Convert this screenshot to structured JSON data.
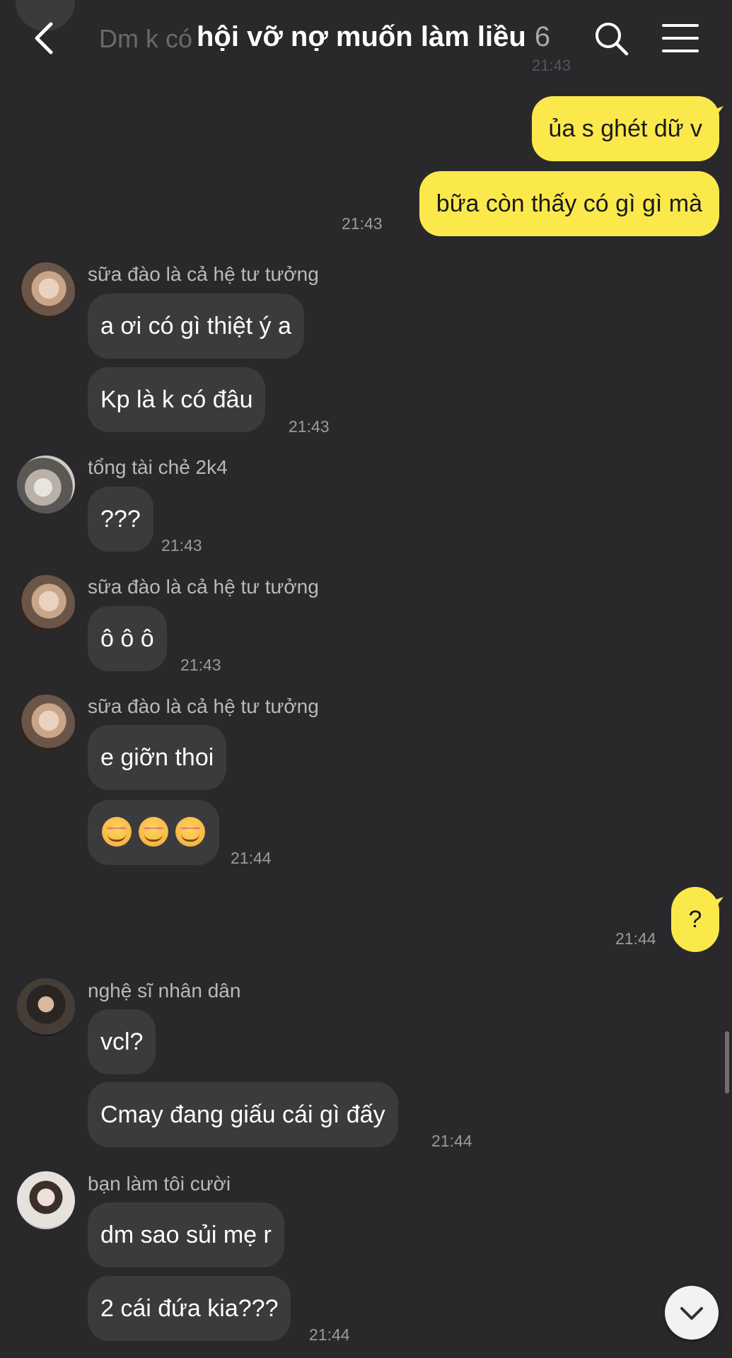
{
  "header": {
    "title": "hội vỡ nợ muốn làm liều",
    "member_count": "6",
    "ghost_text": "Dm k có",
    "ghost_time": "21:43"
  },
  "messages": [
    {
      "dir": "out",
      "text": "ủa s ghét dữ v"
    },
    {
      "dir": "out",
      "text": "bữa còn thấy có gì gì mà",
      "time": "21:43"
    },
    {
      "dir": "in",
      "sender": "sữa đào là cả hệ tư tưởng",
      "text": "a ơi có gì thiệt ý a"
    },
    {
      "dir": "in",
      "text": "Kp là k có đâu",
      "time": "21:43"
    },
    {
      "dir": "in",
      "sender": "tổng tài chẻ 2k4",
      "text": "???",
      "time": "21:43"
    },
    {
      "dir": "in",
      "sender": "sữa đào là cả hệ tư tưởng",
      "text": "ô ô ô",
      "time": "21:43"
    },
    {
      "dir": "in",
      "sender": "sữa đào là cả hệ tư tưởng",
      "text": "e giỡn thoi"
    },
    {
      "dir": "in",
      "emoji": [
        "smiling-face-icon",
        "smiling-face-icon",
        "smiling-face-icon"
      ],
      "time": "21:44"
    },
    {
      "dir": "out",
      "text": "?",
      "time": "21:44"
    },
    {
      "dir": "in",
      "sender": "nghệ sĩ nhân dân",
      "text": "vcl?"
    },
    {
      "dir": "in",
      "text": "Cmay đang giấu cái gì đấy",
      "time": "21:44"
    },
    {
      "dir": "in",
      "sender": "bạn làm tôi cười",
      "text": "dm sao sủi mẹ r"
    },
    {
      "dir": "in",
      "text": "2 cái đứa kia???",
      "time": "21:44"
    }
  ],
  "colors": {
    "background": "#29292b",
    "incoming_bubble": "#3b3b3d",
    "outgoing_bubble": "#fbe94c"
  },
  "icons": {
    "back": "chevron-left-icon",
    "search": "search-icon",
    "menu": "hamburger-menu-icon",
    "scroll_down": "chevron-down-icon"
  }
}
